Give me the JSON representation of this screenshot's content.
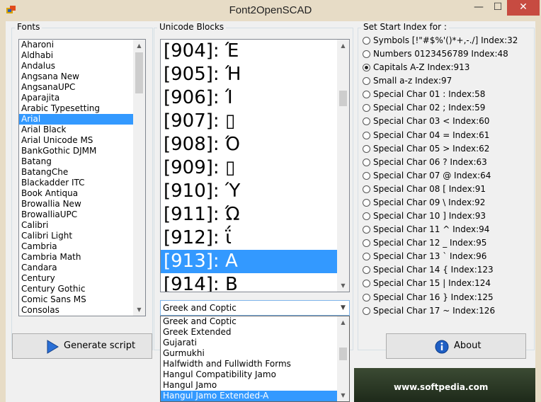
{
  "window": {
    "title": "Font2OpenSCAD",
    "minimize": "—",
    "maximize": "☐",
    "close": "✕"
  },
  "fonts": {
    "label": "Fonts",
    "items": [
      "Aharoni",
      "Aldhabi",
      "Andalus",
      "Angsana New",
      "AngsanaUPC",
      "Aparajita",
      "Arabic Typesetting",
      "Arial",
      "Arial Black",
      "Arial Unicode MS",
      "BankGothic DJMM",
      "Batang",
      "BatangChe",
      "Blackadder ITC",
      "Book Antiqua",
      "Browallia New",
      "BrowalliaUPC",
      "Calibri",
      "Calibri Light",
      "Cambria",
      "Cambria Math",
      "Candara",
      "Century",
      "Century Gothic",
      "Comic Sans MS",
      "Consolas"
    ],
    "selected_index": 7
  },
  "blocks": {
    "label": "Unicode Blocks",
    "glyphs": [
      "[904]: Έ",
      "[905]: Ή",
      "[906]: Ί",
      "[907]: ▯",
      "[908]: Ό",
      "[909]: ▯",
      "[910]: Ύ",
      "[911]: Ώ",
      "[912]: ΐ",
      "[913]: Α",
      "[914]: Β"
    ],
    "selected_index": 9,
    "combo_value": "Greek and Coptic",
    "dropdown": [
      "Greek and Coptic",
      "Greek Extended",
      "Gujarati",
      "Gurmukhi",
      "Halfwidth and Fullwidth Forms",
      "Hangul Compatibility Jamo",
      "Hangul Jamo",
      "Hangul Jamo Extended-A"
    ],
    "dropdown_selected_index": 7
  },
  "start_index": {
    "label": "Set Start Index for :",
    "options": [
      "Symbols [!\"#$%'()*+,-./] Index:32",
      "Numbers 0123456789 Index:48",
      "Capitals A-Z Index:913",
      "Small a-z Index:97",
      "Special Char 01 : Index:58",
      "Special Char 02 ; Index:59",
      "Special Char 03 < Index:60",
      "Special Char 04 = Index:61",
      "Special Char 05 > Index:62",
      "Special Char 06 ? Index:63",
      "Special Char 07 @ Index:64",
      "Special Char 08 [ Index:91",
      "Special Char 09 \\ Index:92",
      "Special Char 10 ] Index:93",
      "Special Char 11 ^ Index:94",
      "Special Char 12  _ Index:95",
      "Special Char 13  ` Index:96",
      "Special Char 14  { Index:123",
      "Special Char 15  | Index:124",
      "Special Char 16  } Index:125",
      "Special Char 17 ~ Index:126"
    ],
    "selected_index": 2
  },
  "buttons": {
    "generate": "Generate script",
    "about": "About"
  },
  "watermark": "www.softpedia.com",
  "colors": {
    "selection": "#3399ff",
    "titlebar": "#e7dcc6",
    "close": "#c74b41"
  }
}
